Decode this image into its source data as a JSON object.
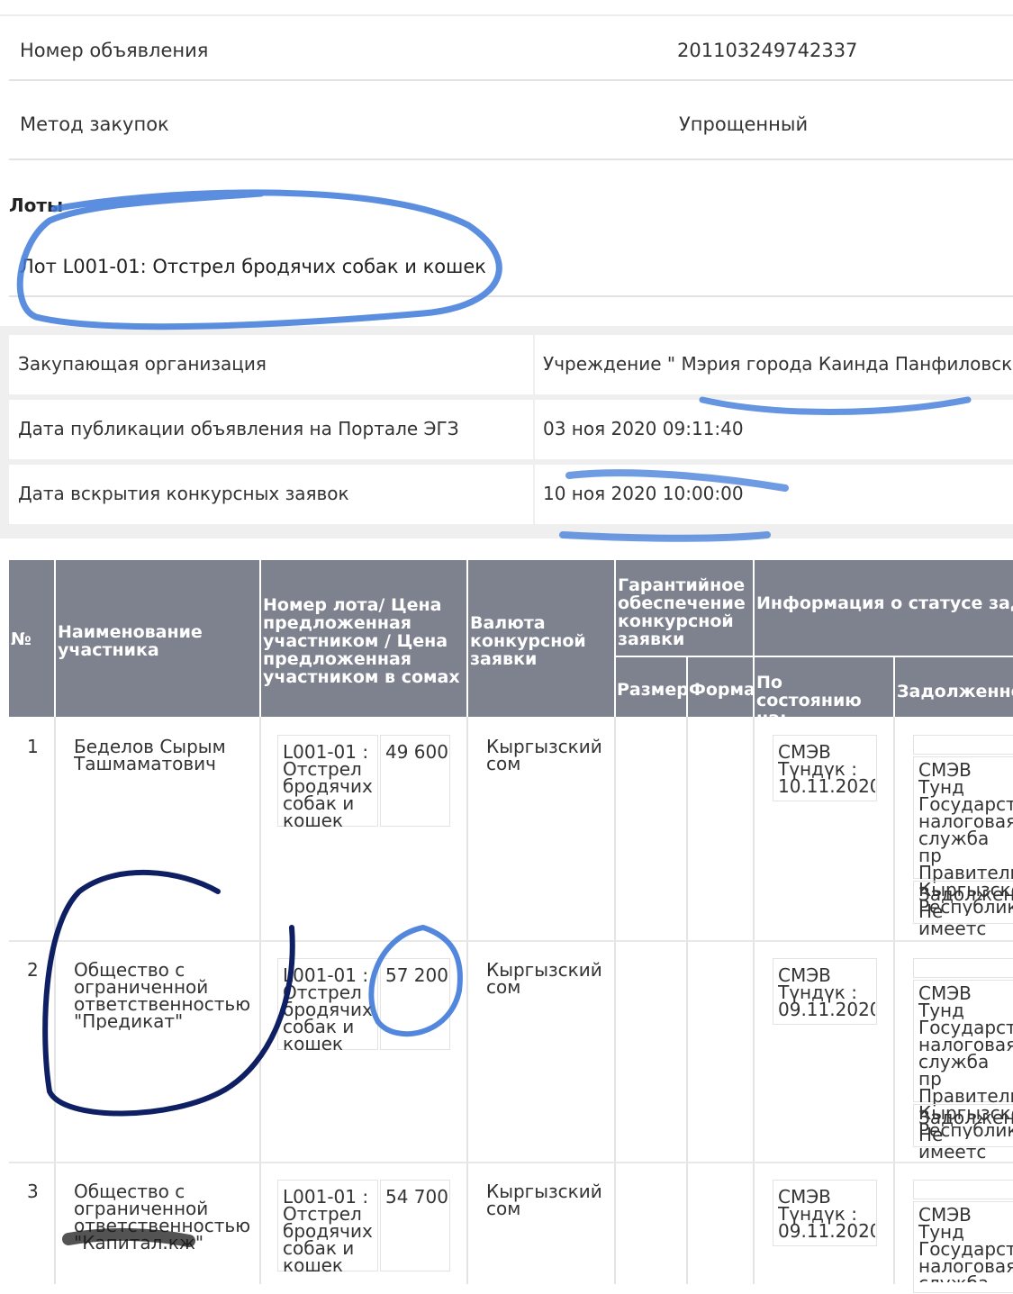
{
  "announcement": {
    "number_label": "Номер объявления",
    "number_value": "201103249742337",
    "method_label": "Метод закупок",
    "method_value": "Упрощенный"
  },
  "lots": {
    "title": "Лоты",
    "lot_name": "Лот L001-01: Отстрел бродячих собак и кошек"
  },
  "info": {
    "org_label": "Закупающая организация",
    "org_value": "Учреждение \" Мэрия города Каинда Панфиловско",
    "pub_label": "Дата публикации объявления на Портале ЭГЗ",
    "pub_value": "03 ноя 2020 09:11:40",
    "open_label": "Дата вскрытия конкурсных заявок",
    "open_value": "10 ноя 2020 10:00:00"
  },
  "table": {
    "headers": {
      "num": "№",
      "name": "Наименование участника",
      "lot_price": "Номер лота/ Цена предложенная участником / Цена предложенная участником в сомах",
      "currency": "Валюта конкурсной заявки",
      "guarantee": "Гарантийное обеспечение конкурсной заявки",
      "size": "Размер",
      "form": "Форма",
      "tax": "Информация о статусе задолженности по налогам",
      "as_of": "По состоянию на:",
      "debt": "Задолженно"
    },
    "rows": [
      {
        "num": "1",
        "name": "Беделов Сырым Ташмаматович",
        "lot": "L001-01 : Отстрел бродячих собак и кошек",
        "price": "49 600",
        "currency": "Кыргызский сом",
        "as_of": "СМЭВ Түндүк : 10.11.2020",
        "debt_org": "СМЭВ Тунд Государст налоговая служба пр Правитель Кыргызско Республик",
        "debt_status": "Задолжен Не имеетс"
      },
      {
        "num": "2",
        "name": "Общество с ограниченной ответственностью \"Предикат\"",
        "lot": "L001-01 : Отстрел бродячих собак и кошек",
        "price": "57 200",
        "currency": "Кыргызский сом",
        "as_of": "СМЭВ Түндүк : 09.11.2020",
        "debt_org": "СМЭВ Тунд Государст налоговая служба пр Правитель Кыргызско Республик",
        "debt_status": "Задолжен Не имеетс"
      },
      {
        "num": "3",
        "name": "Общество с ограниченной ответственностью \"Капитал.кж\"",
        "lot": "L001-01 : Отстрел бродячих собак и кошек",
        "price": "54 700",
        "currency": "Кыргызский сом",
        "as_of": "СМЭВ Түндүк : 09.11.2020",
        "debt_org": "СМЭВ Тунд Государст налоговая служба пр Правитель",
        "debt_status": ""
      }
    ]
  },
  "colors": {
    "header_bg": "#7d828e",
    "highlight_blue": "#3f7ad9",
    "marker_dark_blue": "#0f1f63"
  }
}
